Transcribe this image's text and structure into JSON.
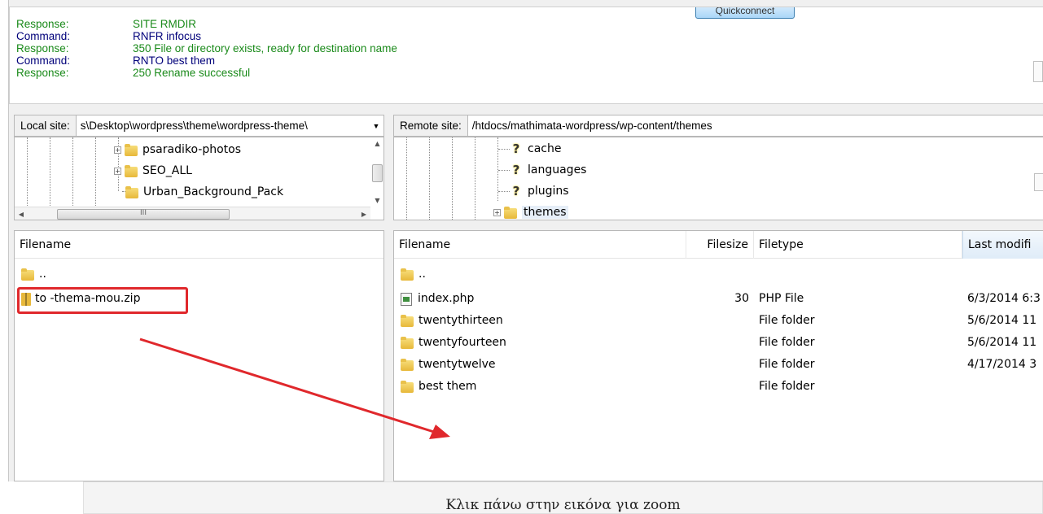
{
  "log": {
    "queue_button_label": "Quickconnect",
    "entries": [
      {
        "type": "Response:",
        "message": "SITE RMDIR"
      },
      {
        "type": "Command:",
        "message": "RNFR infocus"
      },
      {
        "type": "Response:",
        "message": "350 File or directory exists, ready for destination name"
      },
      {
        "type": "Command:",
        "message": "RNTO best them"
      },
      {
        "type": "Response:",
        "message": "250 Rename successful"
      }
    ]
  },
  "local": {
    "site_label": "Local site:",
    "path": "s\\Desktop\\wordpress\\theme\\wordpress-theme\\",
    "dropdown_arrow": "▼",
    "tree": [
      {
        "name": "psaradiko-photos",
        "expander": "+"
      },
      {
        "name": "SEO_ALL",
        "expander": "+"
      },
      {
        "name": "Urban_Background_Pack",
        "expander": ""
      }
    ],
    "hscroll_grip": "III",
    "files_header": "Filename",
    "files": [
      {
        "name": ".."
      },
      {
        "name": "to -thema-mou.zip"
      }
    ]
  },
  "remote": {
    "site_label": "Remote site:",
    "path": "/htdocs/mathimata-wordpress/wp-content/themes",
    "tree": [
      {
        "name": "cache",
        "icon": "?"
      },
      {
        "name": "languages",
        "icon": "?"
      },
      {
        "name": "plugins",
        "icon": "?"
      },
      {
        "name": "themes",
        "icon": "folder",
        "expander": "+"
      }
    ],
    "columns": {
      "filename": "Filename",
      "filesize": "Filesize",
      "filetype": "Filetype",
      "modified": "Last modifi"
    },
    "files": [
      {
        "name": "..",
        "size": "",
        "type": "",
        "modified": ""
      },
      {
        "name": "index.php",
        "size": "30",
        "type": "PHP File",
        "modified": "6/3/2014 6:3"
      },
      {
        "name": "twentythirteen",
        "size": "",
        "type": "File folder",
        "modified": "5/6/2014 11"
      },
      {
        "name": "twentyfourteen",
        "size": "",
        "type": "File folder",
        "modified": "5/6/2014 11"
      },
      {
        "name": "twentytwelve",
        "size": "",
        "type": "File folder",
        "modified": "4/17/2014 3"
      },
      {
        "name": "best them",
        "size": "",
        "type": "File folder",
        "modified": ""
      }
    ]
  },
  "caption": "Κλικ πάνω στην εικόνα για zoom",
  "colors": {
    "highlight": "#e0282c",
    "response": "#1a8a1a",
    "command": "#00007a"
  }
}
